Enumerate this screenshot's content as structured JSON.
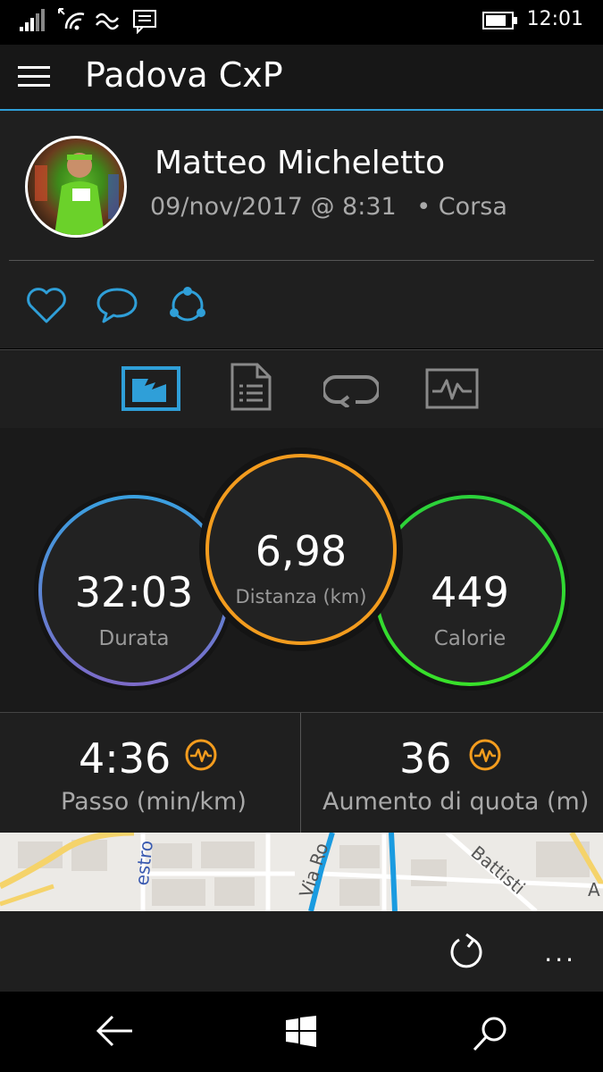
{
  "status_bar": {
    "time": "12:01",
    "icons": [
      "signal-icon",
      "wifi-icon",
      "data-sync-icon",
      "message-icon",
      "battery-icon"
    ]
  },
  "header": {
    "title": "Padova CxP",
    "menu_icon": "hamburger-icon"
  },
  "activity": {
    "user_name": "Matteo Micheletto",
    "datetime": "09/nov/2017 @ 8:31",
    "type": "• Corsa",
    "social_icons": [
      "heart-icon",
      "comment-icon",
      "share-icon"
    ]
  },
  "tabs": [
    {
      "name": "overview-tab",
      "icon": "overview-icon",
      "selected": true
    },
    {
      "name": "details-tab",
      "icon": "document-icon",
      "selected": false
    },
    {
      "name": "laps-tab",
      "icon": "loop-icon",
      "selected": false
    },
    {
      "name": "chart-tab",
      "icon": "chart-icon",
      "selected": false
    }
  ],
  "stats": {
    "duration": {
      "value": "32:03",
      "label": "Durata"
    },
    "distance": {
      "value": "6,98",
      "label": "Distanza (km)"
    },
    "calories": {
      "value": "449",
      "label": "Calorie"
    }
  },
  "metrics": {
    "pace": {
      "value": "4:36",
      "label": "Passo (min/km)",
      "icon": "chart-badge-icon"
    },
    "elevation": {
      "value": "36",
      "label": "Aumento di quota (m)",
      "icon": "chart-badge-icon"
    }
  },
  "map": {
    "streets": [
      "estro",
      "Via Ro",
      "Battisti",
      "A"
    ]
  },
  "app_bar": {
    "refresh_icon": "refresh-icon",
    "more": "..."
  },
  "nav_bar": {
    "icons": [
      "back-icon",
      "windows-icon",
      "search-icon"
    ]
  },
  "colors": {
    "accent_blue": "#2f9fd8",
    "ring_orange": "#f39c1e",
    "ring_green": "#2bd13a",
    "ring_blue": "#3aa0e0",
    "ring_purple": "#7c6bc8"
  }
}
